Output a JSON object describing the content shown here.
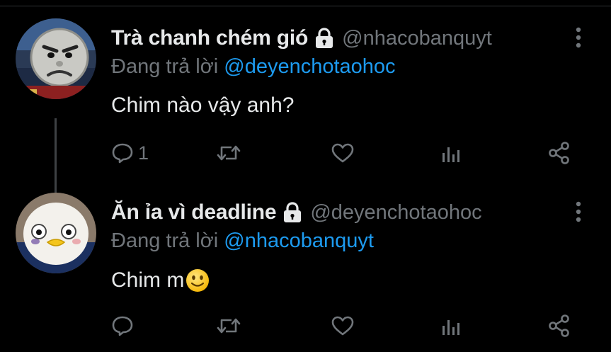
{
  "colors": {
    "background": "#000000",
    "text_primary": "#e7e9ea",
    "text_secondary": "#71767b",
    "accent": "#1d9bf0",
    "thread_line": "#3e4144"
  },
  "tweets": [
    {
      "display_name": "Trà chanh chém gió",
      "protected_icon": "lock-icon",
      "handle": "@nhacobanquyt",
      "replying_prefix": "Đang trả lời",
      "replying_to": "@deyenchotaohoc",
      "text": "Chim nào vậy anh?",
      "emoji": "",
      "avatar": "avatar-angry-train-face",
      "actions": {
        "reply_count": "1",
        "retweet_count": "",
        "like_count": "",
        "stats_count": ""
      }
    },
    {
      "display_name": "Ăn ỉa vì deadline",
      "protected_icon": "lock-icon",
      "handle": "@deyenchotaohoc",
      "replying_prefix": "Đang trả lời",
      "replying_to": "@nhacobanquyt",
      "text": "Chim m",
      "emoji": "slightly-smiling-face-emoji",
      "avatar": "avatar-white-duck-face",
      "actions": {
        "reply_count": "",
        "retweet_count": "",
        "like_count": "",
        "stats_count": ""
      }
    }
  ]
}
